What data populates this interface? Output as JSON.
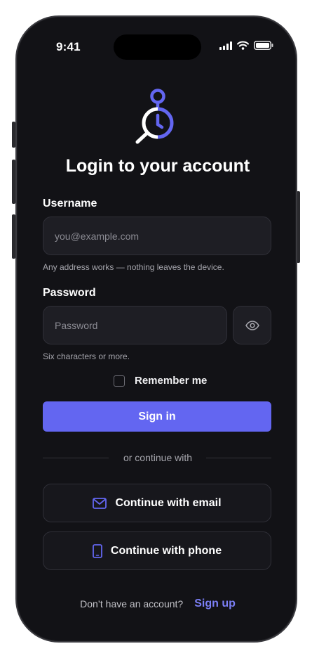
{
  "status": {
    "time": "9:41"
  },
  "colors": {
    "accent": "#6366f1",
    "background": "#121216",
    "field": "#1e1e24"
  },
  "header": {
    "title": "Login to your account",
    "logo_icon": "stopwatch-magnifier-icon"
  },
  "username": {
    "label": "Username",
    "placeholder": "you@example.com",
    "hint": "Any address works — nothing leaves the device."
  },
  "password": {
    "label": "Password",
    "placeholder": "Password",
    "hint": "Six characters or more.",
    "toggle_icon": "eye-icon"
  },
  "remember": {
    "label": "Remember me",
    "checked": false
  },
  "signin": {
    "label": "Sign in"
  },
  "divider": {
    "text": "or continue with"
  },
  "alt_auth": [
    {
      "label": "Continue with email",
      "icon": "mail-icon"
    },
    {
      "label": "Continue with phone",
      "icon": "phone-icon"
    }
  ],
  "footer": {
    "prompt": "Don’t have an account?",
    "link": "Sign up"
  }
}
